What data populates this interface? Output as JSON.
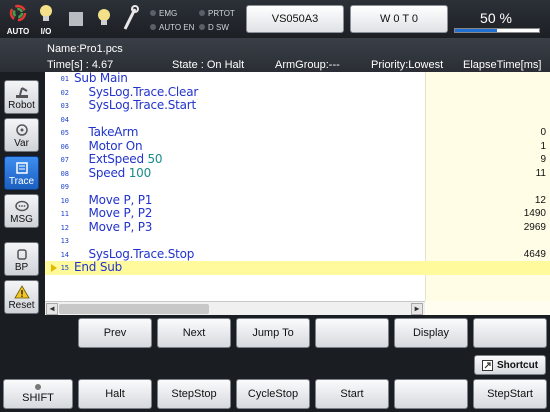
{
  "top": {
    "auto_label": "AUTO",
    "io_label": "I/O",
    "indicators": [
      "EMG",
      "PRTOT",
      "AUTO EN",
      "D SW"
    ],
    "robot_name": "VS050A3",
    "work_label": "W 0 T 0",
    "speed_percent": "50 %",
    "speed_fraction": 0.5
  },
  "info": {
    "name": "Name:Pro1.pcs",
    "time": "Time[s] : 4.67",
    "state": "State : On Halt",
    "armgroup": "ArmGroup:---",
    "priority": "Priority:Lowest",
    "elapse": "ElapseTime[ms]"
  },
  "side": {
    "robot": "Robot",
    "var": "Var",
    "trace": "Trace",
    "msg": "MSG",
    "bp": "BP",
    "reset": "Reset"
  },
  "program": [
    {
      "ln": "01",
      "code": "Sub Main",
      "t": ""
    },
    {
      "ln": "02",
      "code": "    SysLog.Trace.Clear",
      "t": ""
    },
    {
      "ln": "03",
      "code": "    SysLog.Trace.Start",
      "t": ""
    },
    {
      "ln": "04",
      "code": "",
      "t": ""
    },
    {
      "ln": "05",
      "code": "    TakeArm",
      "t": "0"
    },
    {
      "ln": "06",
      "code": "    Motor On",
      "t": "1"
    },
    {
      "ln": "07",
      "code": "    ExtSpeed ",
      "num": "50",
      "t": "9"
    },
    {
      "ln": "08",
      "code": "    Speed ",
      "num": "100",
      "t": "11"
    },
    {
      "ln": "09",
      "code": "",
      "t": ""
    },
    {
      "ln": "10",
      "code": "    Move P, P1",
      "t": "12"
    },
    {
      "ln": "11",
      "code": "    Move P, P2",
      "t": "1490"
    },
    {
      "ln": "12",
      "code": "    Move P, P3",
      "t": "2969"
    },
    {
      "ln": "13",
      "code": "",
      "t": ""
    },
    {
      "ln": "14",
      "code": "    SysLog.Trace.Stop",
      "t": "4649"
    },
    {
      "ln": "15",
      "code": "End Sub",
      "t": "",
      "current": true
    },
    {
      "ln": "",
      "code": "",
      "t": ""
    }
  ],
  "row1": [
    "Prev",
    "Next",
    "Jump To",
    "",
    "Display",
    ""
  ],
  "shortcut_label": "Shortcut",
  "row2": [
    "SHIFT",
    "Halt",
    "StepStop",
    "CycleStop",
    "Start",
    "",
    "StepStart"
  ]
}
